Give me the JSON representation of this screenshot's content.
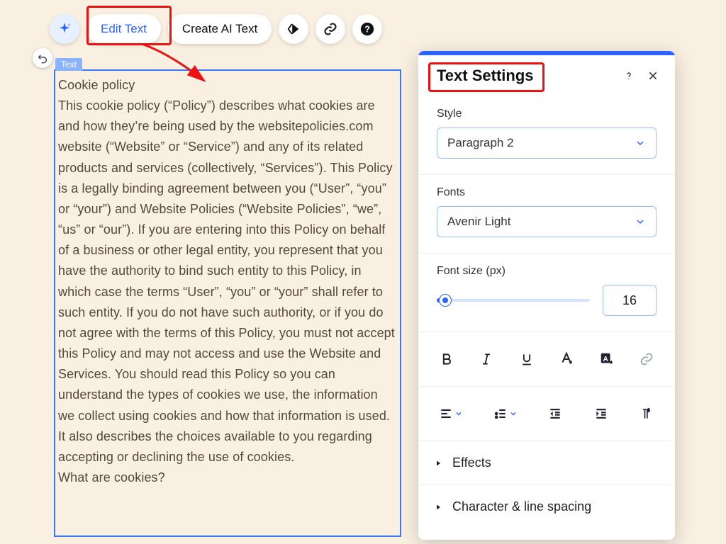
{
  "toolbar": {
    "edit_text_label": "Edit Text",
    "create_ai_text_label": "Create AI Text"
  },
  "text_area": {
    "badge_label": "Text",
    "content": "Cookie policy\nThis cookie policy (“Policy”) describes what cookies are and how they’re being used by the websitepolicies.com website (“Website” or “Service”) and any of its related products and services (collectively, “Services”). This Policy is a legally binding agreement between you (“User”, “you” or “your”) and Website Policies (“Website Policies”, “we”, “us” or “our”). If you are entering into this Policy on behalf of a business or other legal entity, you represent that you have the authority to bind such entity to this Policy, in which case the terms “User”, “you” or “your” shall refer to such entity. If you do not have such authority, or if you do not agree with the terms of this Policy, you must not accept this Policy and may not access and use the Website and Services. You should read this Policy so you can understand the types of cookies we use, the information we collect using cookies and how that information is used. It also describes the choices available to you regarding accepting or declining the use of cookies.\nWhat are cookies?"
  },
  "settings": {
    "title": "Text Settings",
    "style_label": "Style",
    "style_value": "Paragraph 2",
    "fonts_label": "Fonts",
    "fonts_value": "Avenir Light",
    "font_size_label": "Font size (px)",
    "font_size_value": "16",
    "effects_label": "Effects",
    "char_line_label": "Character & line spacing"
  },
  "icons": {
    "sparkle": "sparkle",
    "animation": "animation",
    "link": "link",
    "help": "help",
    "undo": "undo",
    "close": "close"
  }
}
